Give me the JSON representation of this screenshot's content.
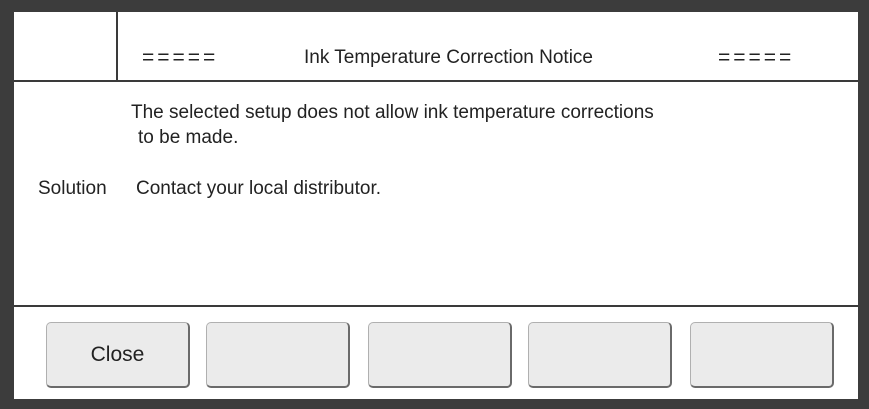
{
  "dialog": {
    "title_left_decoration": "=====",
    "title": "Ink Temperature Correction Notice",
    "title_right_decoration": "=====",
    "message_line1": "The selected setup does not allow ink temperature corrections",
    "message_line2": "to be made.",
    "solution_label": "Solution",
    "solution_text": "Contact your local distributor."
  },
  "buttons": {
    "close_label": "Close",
    "button2_label": "",
    "button3_label": "",
    "button4_label": "",
    "button5_label": ""
  }
}
